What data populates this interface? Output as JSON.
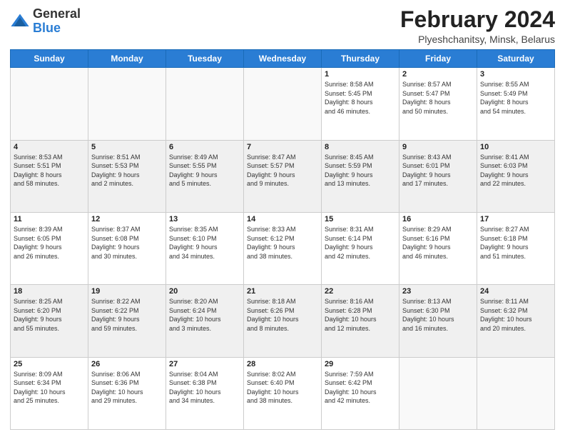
{
  "header": {
    "logo": {
      "general": "General",
      "blue": "Blue"
    },
    "title": "February 2024",
    "location": "Plyeshchanitsy, Minsk, Belarus"
  },
  "days_of_week": [
    "Sunday",
    "Monday",
    "Tuesday",
    "Wednesday",
    "Thursday",
    "Friday",
    "Saturday"
  ],
  "weeks": [
    {
      "alt": false,
      "days": [
        {
          "num": "",
          "info": ""
        },
        {
          "num": "",
          "info": ""
        },
        {
          "num": "",
          "info": ""
        },
        {
          "num": "",
          "info": ""
        },
        {
          "num": "1",
          "info": "Sunrise: 8:58 AM\nSunset: 5:45 PM\nDaylight: 8 hours\nand 46 minutes."
        },
        {
          "num": "2",
          "info": "Sunrise: 8:57 AM\nSunset: 5:47 PM\nDaylight: 8 hours\nand 50 minutes."
        },
        {
          "num": "3",
          "info": "Sunrise: 8:55 AM\nSunset: 5:49 PM\nDaylight: 8 hours\nand 54 minutes."
        }
      ]
    },
    {
      "alt": true,
      "days": [
        {
          "num": "4",
          "info": "Sunrise: 8:53 AM\nSunset: 5:51 PM\nDaylight: 8 hours\nand 58 minutes."
        },
        {
          "num": "5",
          "info": "Sunrise: 8:51 AM\nSunset: 5:53 PM\nDaylight: 9 hours\nand 2 minutes."
        },
        {
          "num": "6",
          "info": "Sunrise: 8:49 AM\nSunset: 5:55 PM\nDaylight: 9 hours\nand 5 minutes."
        },
        {
          "num": "7",
          "info": "Sunrise: 8:47 AM\nSunset: 5:57 PM\nDaylight: 9 hours\nand 9 minutes."
        },
        {
          "num": "8",
          "info": "Sunrise: 8:45 AM\nSunset: 5:59 PM\nDaylight: 9 hours\nand 13 minutes."
        },
        {
          "num": "9",
          "info": "Sunrise: 8:43 AM\nSunset: 6:01 PM\nDaylight: 9 hours\nand 17 minutes."
        },
        {
          "num": "10",
          "info": "Sunrise: 8:41 AM\nSunset: 6:03 PM\nDaylight: 9 hours\nand 22 minutes."
        }
      ]
    },
    {
      "alt": false,
      "days": [
        {
          "num": "11",
          "info": "Sunrise: 8:39 AM\nSunset: 6:05 PM\nDaylight: 9 hours\nand 26 minutes."
        },
        {
          "num": "12",
          "info": "Sunrise: 8:37 AM\nSunset: 6:08 PM\nDaylight: 9 hours\nand 30 minutes."
        },
        {
          "num": "13",
          "info": "Sunrise: 8:35 AM\nSunset: 6:10 PM\nDaylight: 9 hours\nand 34 minutes."
        },
        {
          "num": "14",
          "info": "Sunrise: 8:33 AM\nSunset: 6:12 PM\nDaylight: 9 hours\nand 38 minutes."
        },
        {
          "num": "15",
          "info": "Sunrise: 8:31 AM\nSunset: 6:14 PM\nDaylight: 9 hours\nand 42 minutes."
        },
        {
          "num": "16",
          "info": "Sunrise: 8:29 AM\nSunset: 6:16 PM\nDaylight: 9 hours\nand 46 minutes."
        },
        {
          "num": "17",
          "info": "Sunrise: 8:27 AM\nSunset: 6:18 PM\nDaylight: 9 hours\nand 51 minutes."
        }
      ]
    },
    {
      "alt": true,
      "days": [
        {
          "num": "18",
          "info": "Sunrise: 8:25 AM\nSunset: 6:20 PM\nDaylight: 9 hours\nand 55 minutes."
        },
        {
          "num": "19",
          "info": "Sunrise: 8:22 AM\nSunset: 6:22 PM\nDaylight: 9 hours\nand 59 minutes."
        },
        {
          "num": "20",
          "info": "Sunrise: 8:20 AM\nSunset: 6:24 PM\nDaylight: 10 hours\nand 3 minutes."
        },
        {
          "num": "21",
          "info": "Sunrise: 8:18 AM\nSunset: 6:26 PM\nDaylight: 10 hours\nand 8 minutes."
        },
        {
          "num": "22",
          "info": "Sunrise: 8:16 AM\nSunset: 6:28 PM\nDaylight: 10 hours\nand 12 minutes."
        },
        {
          "num": "23",
          "info": "Sunrise: 8:13 AM\nSunset: 6:30 PM\nDaylight: 10 hours\nand 16 minutes."
        },
        {
          "num": "24",
          "info": "Sunrise: 8:11 AM\nSunset: 6:32 PM\nDaylight: 10 hours\nand 20 minutes."
        }
      ]
    },
    {
      "alt": false,
      "days": [
        {
          "num": "25",
          "info": "Sunrise: 8:09 AM\nSunset: 6:34 PM\nDaylight: 10 hours\nand 25 minutes."
        },
        {
          "num": "26",
          "info": "Sunrise: 8:06 AM\nSunset: 6:36 PM\nDaylight: 10 hours\nand 29 minutes."
        },
        {
          "num": "27",
          "info": "Sunrise: 8:04 AM\nSunset: 6:38 PM\nDaylight: 10 hours\nand 34 minutes."
        },
        {
          "num": "28",
          "info": "Sunrise: 8:02 AM\nSunset: 6:40 PM\nDaylight: 10 hours\nand 38 minutes."
        },
        {
          "num": "29",
          "info": "Sunrise: 7:59 AM\nSunset: 6:42 PM\nDaylight: 10 hours\nand 42 minutes."
        },
        {
          "num": "",
          "info": ""
        },
        {
          "num": "",
          "info": ""
        }
      ]
    }
  ]
}
